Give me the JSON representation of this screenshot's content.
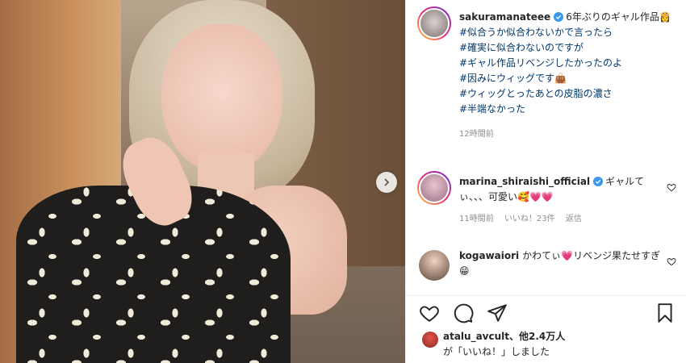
{
  "post": {
    "author": "sakuramanateee",
    "caption_first": "6年ぶりのギャル作品",
    "caption_lines": [
      "#似合うか似合わないかで言ったら",
      "#確実に似合わないのですが",
      "#ギャル作品リベンジしたかったのよ",
      "#因みにウィッグです",
      "#ウィッグとったあとの皮脂の濃さ",
      "#半端なかった"
    ],
    "emoji_after_first": "👸",
    "emoji_wig": "👜",
    "time": "12時間前"
  },
  "comments": [
    {
      "user": "marina_shiraishi_official",
      "text": "ギャルてぃ、、、可愛い",
      "emojis": "🥰💗💗",
      "time": "11時間前",
      "likes": "いいね！23件",
      "reply": "返信"
    },
    {
      "user": "kogawaiori",
      "text_a": "かわてぃ",
      "emoji_a": "💗",
      "text_b": "リベンジ果たせすぎ",
      "emoji_b": "😁"
    }
  ],
  "likes_line": {
    "liker": "atalu_avcult",
    "others": "、他2.4万人",
    "suffix": "が「いいね！」しました"
  },
  "colors": {
    "text": "#262626",
    "hashtag": "#00376b",
    "meta": "#8e8e8e",
    "verified": "#3897f0"
  },
  "icons": [
    "chevron-right-icon",
    "verified-icon",
    "heart-icon",
    "comment-icon",
    "share-icon",
    "bookmark-icon"
  ]
}
